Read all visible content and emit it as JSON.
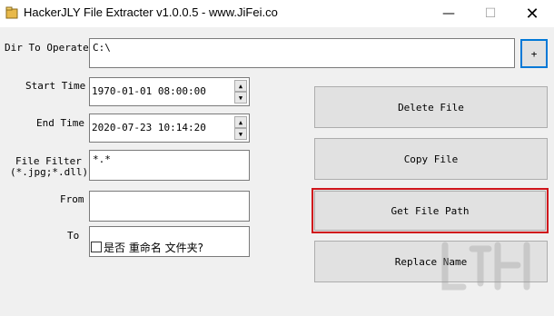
{
  "window": {
    "title": "HackerJLY File Extracter v1.0.0.5 - www.JiFei.co",
    "min_glyph": "—",
    "max_glyph": "☐",
    "close_glyph": "✕"
  },
  "form": {
    "dir_label": "Dir To Operate",
    "dir_value": "C:\\",
    "browse_label": "+",
    "start_label": "Start Time",
    "start_value": "1970-01-01 08:00:00",
    "end_label": "End Time",
    "end_value": "2020-07-23 10:14:20",
    "filter_label_1": "File Filter",
    "filter_label_2": "(*.jpg;*.dll)",
    "filter_value": "*.*",
    "from_label": "From",
    "from_value": "",
    "to_label": "To",
    "to_value": "_",
    "rename_checkbox_label": "是否 重命名 文件夹?",
    "rename_checked": false
  },
  "buttons": {
    "delete": "Delete File",
    "copy": "Copy File",
    "getpath": "Get File Path",
    "replace": "Replace Name"
  },
  "colors": {
    "highlight": "#d0161c",
    "focus_blue": "#0078d7"
  }
}
